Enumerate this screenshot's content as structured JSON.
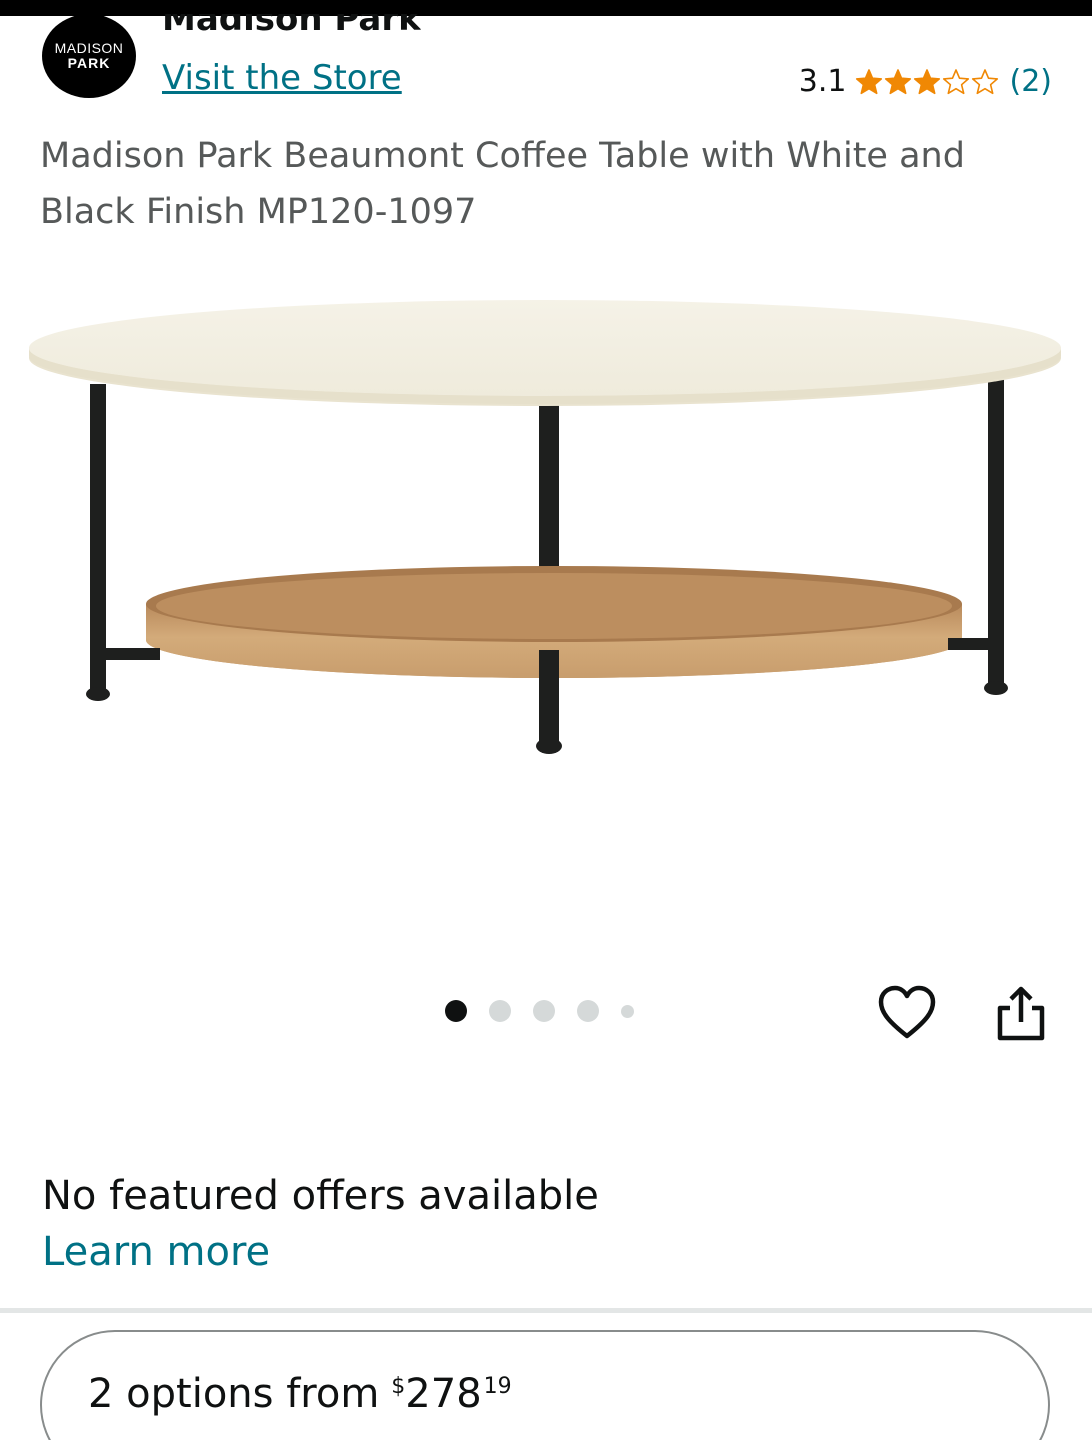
{
  "header": {
    "logo_line1": "MADISON",
    "logo_line2": "PARK",
    "brand_name": "Madison Park",
    "visit_store": "Visit the Store",
    "rating_value": "3.1",
    "rating_stars": 3,
    "rating_count": "(2)",
    "star_color": "#f08804"
  },
  "product": {
    "title": "Madison Park Beaumont Coffee Table with White and Black Finish MP120-1097"
  },
  "carousel": {
    "total_images": 5,
    "active_index": 0
  },
  "icons": {
    "wishlist": "heart-icon",
    "share": "share-icon"
  },
  "offers": {
    "message": "No featured offers available",
    "learn_more": "Learn more"
  },
  "buying_options": {
    "prefix": "2 options from",
    "currency": "$",
    "price_whole": "278",
    "price_fraction": "19"
  },
  "colors": {
    "link": "#007185",
    "text": "#0f1111",
    "muted_text": "#565959"
  }
}
